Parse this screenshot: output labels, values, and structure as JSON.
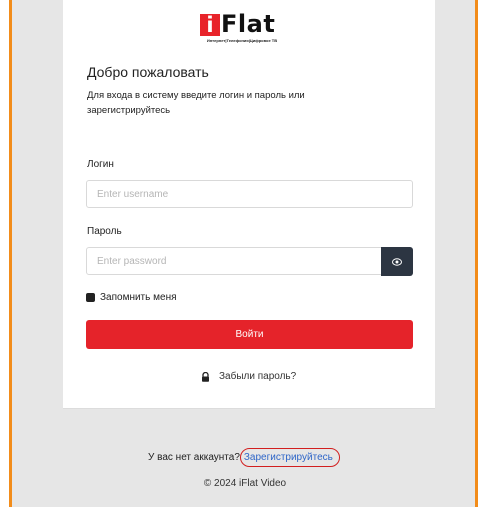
{
  "logo": {
    "letter": "i",
    "wordmark": "Flat",
    "tagline": "Интернет|Телефония|Цифровое ТВ",
    "brand_color": "#e8232a"
  },
  "login_form": {
    "welcome_title": "Добро пожаловать",
    "subtitle": "Для входа в систему введите логин и пароль или зарегистрируйтесь",
    "login_label": "Логин",
    "login_placeholder": "Enter username",
    "password_label": "Пароль",
    "password_placeholder": "Enter password",
    "eye_icon": "eye-icon",
    "remember_label": "Запомнить меня",
    "remember_checked": true,
    "login_button_label": "Войти",
    "forgot_label": "Забыли пароль?",
    "forgot_icon": "lock-icon"
  },
  "footer": {
    "no_account_text": "У вас нет аккаунта?",
    "register_link": "Зарегистрируйтесь",
    "copyright": "© 2024 iFlat Video"
  },
  "colors": {
    "accent": "#e5232a",
    "frame_border": "#f28c1a",
    "link": "#2f66c8",
    "eye_button": "#2c3542"
  }
}
